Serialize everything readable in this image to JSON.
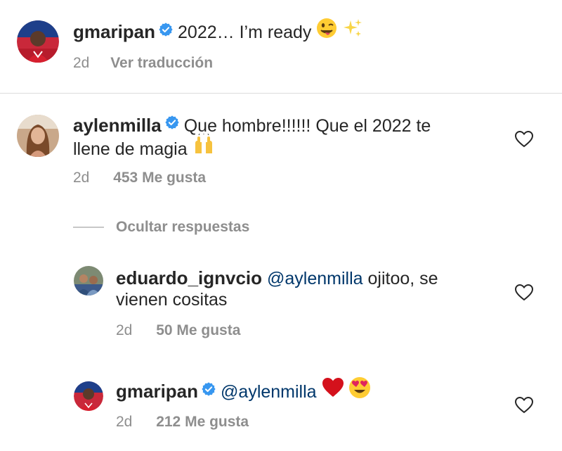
{
  "post": {
    "username": "gmaripan",
    "caption": "2022…  I’m ready",
    "emoji_1": "winking-face-with-tongue",
    "emoji_2": "sparkles",
    "time": "2d",
    "translate": "Ver traducción"
  },
  "comments": [
    {
      "username": "aylenmilla",
      "line_1": "Que hombre!!!!!! Que el 2022 te",
      "line_2": "llene de magia",
      "emoji": "raising-hands",
      "time": "2d",
      "likes": "453 Me gusta"
    }
  ],
  "hide_replies": "Ocultar respuestas",
  "replies": [
    {
      "username": "eduardo_ignvcio",
      "mention": "@aylenmilla",
      "line_1": "ojitoo, se",
      "line_2": "vienen cositas",
      "time": "2d",
      "likes": "50 Me gusta"
    },
    {
      "username": "gmaripan",
      "mention": "@aylenmilla",
      "emoji_1": "red-heart",
      "emoji_2": "smiling-face-with-heart-eyes",
      "time": "2d",
      "likes": "212 Me gusta"
    }
  ],
  "colors": {
    "text": "#262626",
    "secondary": "#8e8e8e",
    "mention": "#00376b",
    "verified": "#3897f0",
    "divider": "#dbdbdb"
  },
  "icons": [
    "verified-badge-icon",
    "heart-outline-icon"
  ]
}
